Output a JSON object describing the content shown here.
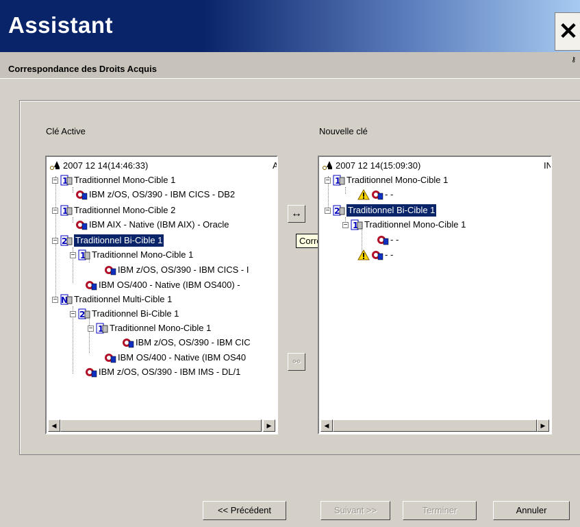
{
  "window": {
    "title": "Assistant",
    "subtitle": "Correspondance des Droits Acquis",
    "close": "✕"
  },
  "left": {
    "label": "Clé Active",
    "root": "2007 12 14(14:46:33)",
    "root_suffix": "A",
    "items": [
      "Traditionnel Mono-Cible 1",
      "IBM z/OS, OS/390 - IBM CICS - DB2",
      "Traditionnel Mono-Cible 2",
      "IBM AIX - Native (IBM AIX) - Oracle",
      "Traditionnel Bi-Cible 1",
      "Traditionnel Mono-Cible 1",
      "IBM z/OS, OS/390 - IBM CICS - I",
      "IBM OS/400 - Native (IBM OS400) -",
      "Traditionnel Multi-Cible 1",
      "Traditionnel Bi-Cible 1",
      "Traditionnel Mono-Cible 1",
      "IBM z/OS, OS/390 - IBM CIC",
      "IBM OS/400 - Native (IBM OS40",
      "IBM z/OS, OS/390 - IBM IMS - DL/1"
    ]
  },
  "right": {
    "label": "Nouvelle clé",
    "root": "2007 12 14(15:09:30)",
    "root_suffix": "IN",
    "items": [
      "Traditionnel Mono-Cible 1",
      "- -",
      "Traditionnel Bi-Cible 1",
      "Traditionnel Mono-Cible 1",
      "- -",
      "- -"
    ]
  },
  "middle": {
    "map_icon": "↔",
    "tooltip": "Correspondance",
    "unmap_icon": "⚯"
  },
  "buttons": {
    "prev": "<< Précédent",
    "next": "Suivant >>",
    "finish": "Terminer",
    "cancel": "Annuler"
  },
  "colors": {
    "selection": "#0a246a",
    "titlebar": "#0a246a",
    "tooltip_bg": "#ffffe1"
  }
}
